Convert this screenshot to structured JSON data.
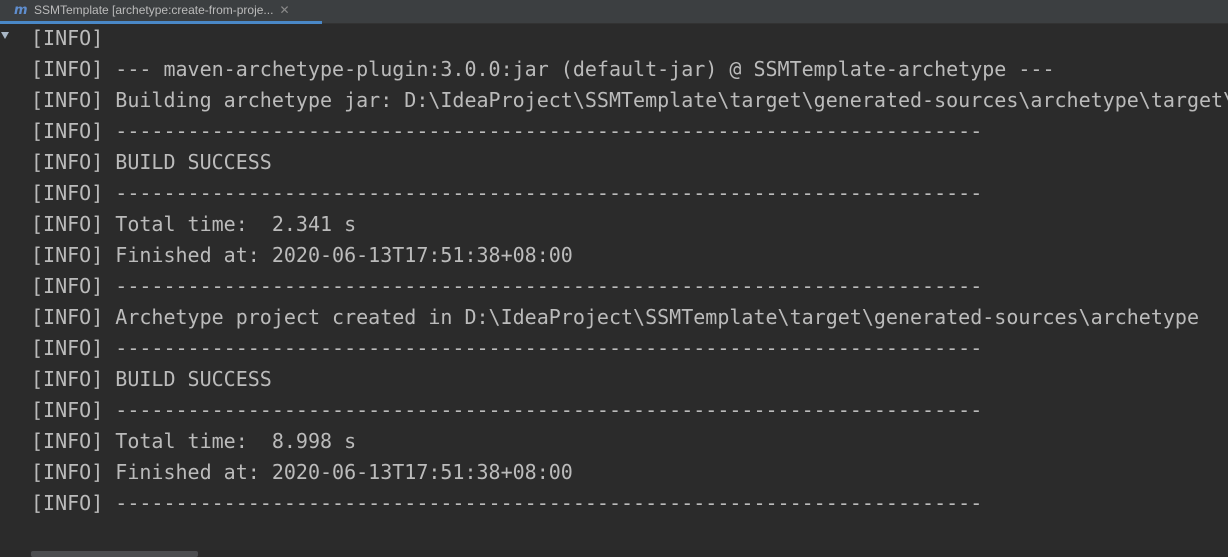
{
  "tab": {
    "icon": "maven-icon",
    "icon_glyph": "m",
    "title": "SSMTemplate [archetype:create-from-proje...",
    "close_glyph": "✕"
  },
  "gutter": {
    "arrow_icon": "scroll-down-arrow-icon"
  },
  "console": {
    "lines": [
      "[INFO]",
      "[INFO] --- maven-archetype-plugin:3.0.0:jar (default-jar) @ SSMTemplate-archetype ---",
      "[INFO] Building archetype jar: D:\\IdeaProject\\SSMTemplate\\target\\generated-sources\\archetype\\target\\",
      "[INFO] ------------------------------------------------------------------------",
      "[INFO] BUILD SUCCESS",
      "[INFO] ------------------------------------------------------------------------",
      "[INFO] Total time:  2.341 s",
      "[INFO] Finished at: 2020-06-13T17:51:38+08:00",
      "[INFO] ------------------------------------------------------------------------",
      "[INFO] Archetype project created in D:\\IdeaProject\\SSMTemplate\\target\\generated-sources\\archetype",
      "[INFO] ------------------------------------------------------------------------",
      "[INFO] BUILD SUCCESS",
      "[INFO] ------------------------------------------------------------------------",
      "[INFO] Total time:  8.998 s",
      "[INFO] Finished at: 2020-06-13T17:51:38+08:00",
      "[INFO] ------------------------------------------------------------------------"
    ]
  },
  "colors": {
    "background": "#2b2b2b",
    "text": "#bbbbbb",
    "tab_underline": "#4a88c7"
  }
}
